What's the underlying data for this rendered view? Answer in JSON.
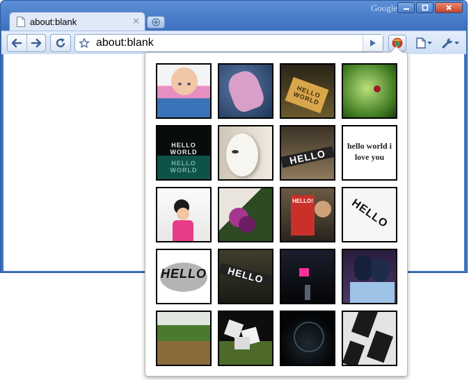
{
  "window": {
    "brand": "Google",
    "controls": [
      "minimize",
      "maximize",
      "close"
    ]
  },
  "tab": {
    "title": "about:blank",
    "close_icon": "close-icon",
    "new_tab_icon": "plus-icon"
  },
  "toolbar": {
    "url": "about:blank",
    "icons": [
      "back-arrow-icon",
      "forward-arrow-icon",
      "reload-icon",
      "star-icon",
      "go-arrow-icon",
      "extension-icon",
      "page-menu-icon",
      "wrench-icon"
    ]
  },
  "colors": {
    "frame": "#3e72c0",
    "toolbar": "#dbe6f5",
    "popup_border": "#b9b9b9"
  },
  "popup": {
    "thumbnails": [
      {
        "subject": "baby face on pink",
        "text": ""
      },
      {
        "subject": "hand with writing",
        "text": ""
      },
      {
        "subject": "hello world cookie",
        "text": "HELLO WORLD"
      },
      {
        "subject": "green bug on leaf",
        "text": ""
      },
      {
        "subject": "hello world neon reflection",
        "text": "HELLO WORLD"
      },
      {
        "subject": "white mask",
        "text": ""
      },
      {
        "subject": "hello world pixel street",
        "text": "HELLO"
      },
      {
        "subject": "hello world i love you",
        "text": "hello world i love you"
      },
      {
        "subject": "girl in pink",
        "text": ""
      },
      {
        "subject": "purple flowers",
        "text": ""
      },
      {
        "subject": "magazine reader",
        "text": "HELLO!"
      },
      {
        "subject": "hello world pixel letters",
        "text": "HELLO"
      },
      {
        "subject": "hello world black letters",
        "text": "HELLO"
      },
      {
        "subject": "hello world pixel wall",
        "text": "HELLO"
      },
      {
        "subject": "dark hall pink light",
        "text": ""
      },
      {
        "subject": "blue shoes",
        "text": ""
      },
      {
        "subject": "grass field",
        "text": ""
      },
      {
        "subject": "white blocks at night",
        "text": ""
      },
      {
        "subject": "dark tunnel",
        "text": ""
      },
      {
        "subject": "puzzle tiles",
        "text": ""
      }
    ]
  }
}
